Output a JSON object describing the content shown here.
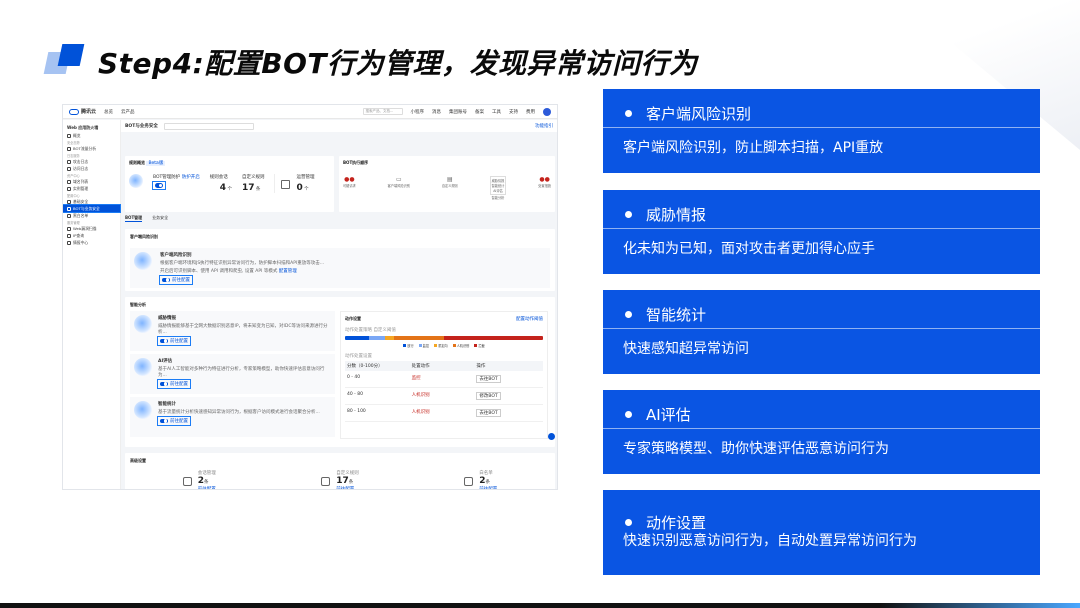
{
  "slide": {
    "title": "Step4:配置BOT行为管理，发现异常访问行为"
  },
  "screenshot": {
    "brand": "腾讯云",
    "nav": [
      "总览",
      "云产品"
    ],
    "search_placeholder": "搜索产品、文档...",
    "topbar_right": [
      "小程序",
      "消息",
      "集团账号",
      "备案",
      "工具",
      "支持",
      "费用"
    ],
    "sidebar": {
      "product": "Web 应用防火墙",
      "items": [
        {
          "type": "item",
          "label": "概览"
        },
        {
          "type": "section",
          "label": "安全态势"
        },
        {
          "type": "item",
          "label": "BOT流量分析"
        },
        {
          "type": "section",
          "label": "日志服务"
        },
        {
          "type": "item",
          "label": "攻击日志"
        },
        {
          "type": "item",
          "label": "访问日志"
        },
        {
          "type": "section",
          "label": "资产中心"
        },
        {
          "type": "item",
          "label": "域名列表"
        },
        {
          "type": "item",
          "label": "实例管理"
        },
        {
          "type": "section",
          "label": "配置中心"
        },
        {
          "type": "item",
          "label": "基础安全"
        },
        {
          "type": "item",
          "label": "BOT与业务安全",
          "active": true
        },
        {
          "type": "item",
          "label": "黑白名单"
        },
        {
          "type": "section",
          "label": "服务管理"
        },
        {
          "type": "item",
          "label": "Web漏洞扫描"
        },
        {
          "type": "item",
          "label": "IP查询"
        },
        {
          "type": "item",
          "label": "情报中心"
        }
      ]
    },
    "page_title": "BOT与业务安全",
    "top_right_link": "功能指引",
    "rule_overview": {
      "title": "规则概览",
      "badge": "Beta版",
      "protect_label": "BOT管理防护",
      "protect_status": "防护开启",
      "session_label": "规则会话",
      "session_value": "4",
      "session_unit": "个",
      "custom_label": "自定义规则",
      "custom_value": "17",
      "custom_unit": "条",
      "settings_label": "运营管理",
      "settings_value": "0",
      "settings_unit": "个"
    },
    "flow": {
      "title": "BOT执行顺序",
      "steps": [
        "可疑请求",
        "客户端风险识别",
        "自定义规则",
        "智能分析",
        "处置措施"
      ],
      "mid_list": [
        "威胁情报",
        "智能统计",
        "AI评估"
      ]
    },
    "tabs": [
      "BOT管理",
      "业务安全"
    ],
    "client_risk": {
      "title": "客户端风险识别",
      "item_title": "客户端风险识别",
      "desc": "根据客户端环境和JS执行特征识别异常访问行为，防护脚本扫描和API重放等攻击...",
      "desc2": "开启后可识别脚本、使用 API 调用和爬虫, 设置 API 等模式",
      "link": "配置管理",
      "toggle_label": "前往配置"
    },
    "smart": {
      "title": "智能分析",
      "items": [
        {
          "title": "威胁情报",
          "desc": "威胁情报能够基于全网大数据识别恶意IP，将未知变为已知，对IDC等访问来源进行分析...",
          "toggle": "前往配置"
        },
        {
          "title": "AI评估",
          "desc": "基于AI人工智能对多种行为特征进行分析，专家策略模型，助你快速评估恶意访问行为...",
          "toggle": "前往配置"
        },
        {
          "title": "智能统计",
          "desc": "基于流量统计分析快速感知异常访问行为，根据客户访问模式进行会话聚合分析...",
          "toggle": "前往配置"
        }
      ]
    },
    "action": {
      "title": "动作设置",
      "link": "配置动作阈值",
      "sub": "动作处置策略",
      "sub2": "自定义阈值",
      "legend": [
        "放行",
        "监控",
        "重定向",
        "人机识别",
        "拦截"
      ],
      "legend_colors": [
        "#0052d9",
        "#7aa7f5",
        "#f5a623",
        "#e37318",
        "#c4231c"
      ],
      "bar_shares": [
        0.12,
        0.08,
        0.05,
        0.25,
        0.5
      ],
      "table_title": "动作处置设置",
      "columns": [
        "分数（0-100分）",
        "处置动作",
        "操作"
      ],
      "rows": [
        {
          "range": "0 - 40",
          "action": "监控",
          "op": "去往BOT"
        },
        {
          "range": "40 - 80",
          "action": "人机识别",
          "op": "修改BOT"
        },
        {
          "range": "80 - 100",
          "action": "人机识别",
          "op": "去往BOT"
        }
      ]
    },
    "advanced": {
      "title": "高级设置",
      "items": [
        {
          "label": "会话管理",
          "value": "2",
          "unit": "条",
          "link": "前往配置"
        },
        {
          "label": "自定义规则",
          "value": "17",
          "unit": "条",
          "link": "前往配置"
        },
        {
          "label": "白名单",
          "value": "2",
          "unit": "条",
          "link": "前往配置"
        }
      ]
    }
  },
  "panels": [
    {
      "heading": "客户端风险识别",
      "desc": "客户端风险识别，防止脚本扫描，API重放"
    },
    {
      "heading": "威胁情报",
      "desc": "化未知为已知，面对攻击者更加得心应手"
    },
    {
      "heading": "智能统计",
      "desc": "快速感知超异常访问"
    },
    {
      "heading": "AI评估",
      "desc": "专家策略模型、助你快速评估恶意访问行为"
    },
    {
      "heading": "动作设置",
      "desc": "快速识别恶意访问行为，自动处置异常访问行为"
    }
  ]
}
